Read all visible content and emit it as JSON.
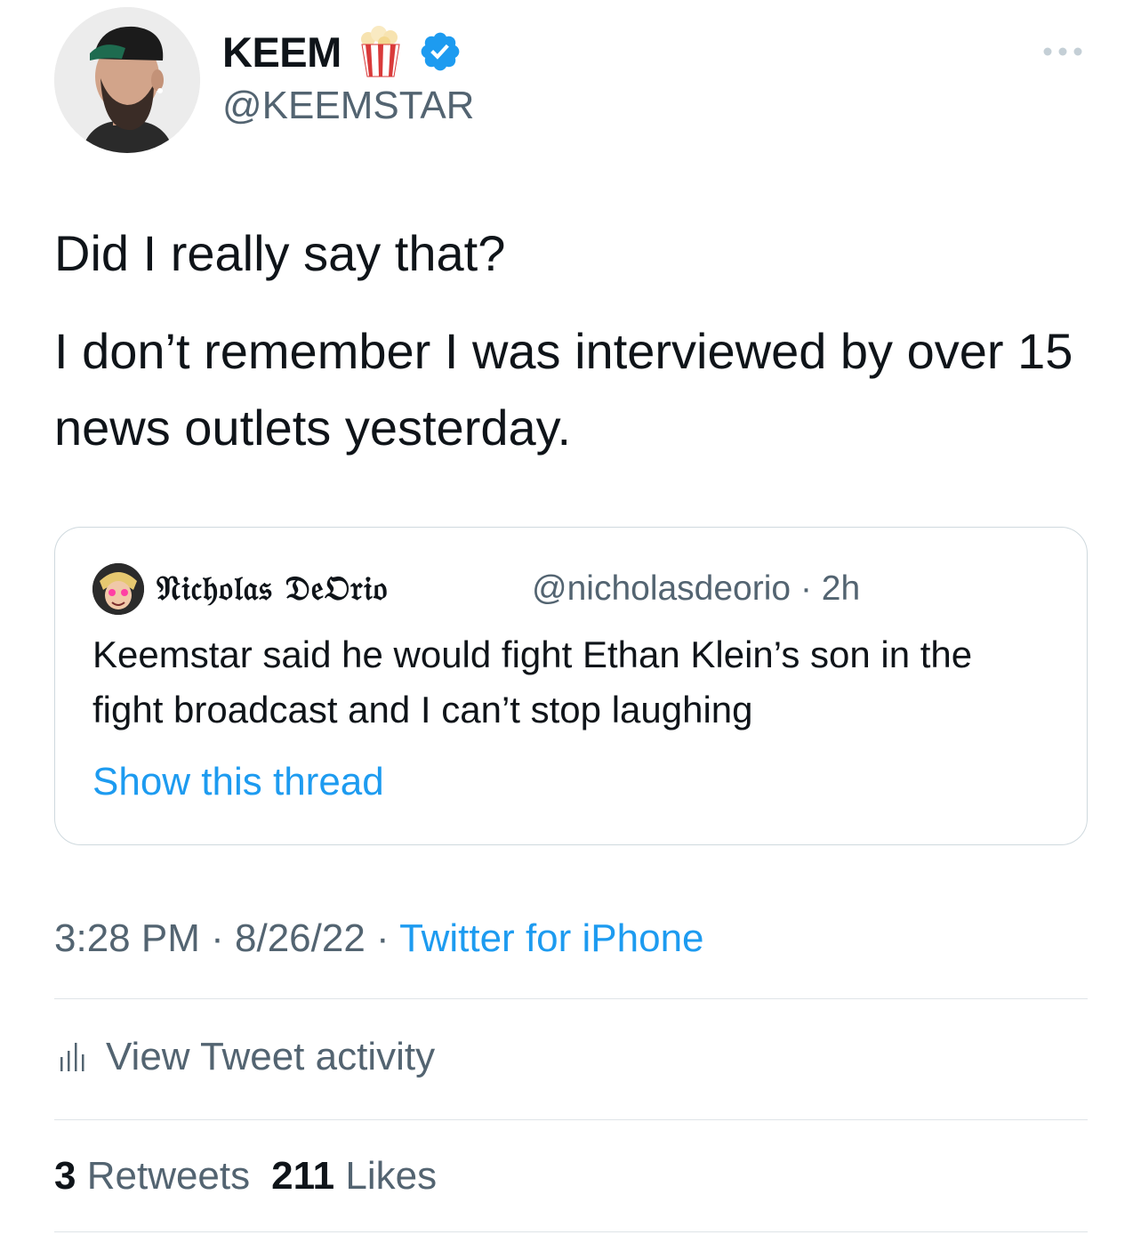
{
  "author": {
    "display_name": "KEEM",
    "name_emoji": "popcorn-icon",
    "verified": true,
    "handle": "@KEEMSTAR"
  },
  "tweet": {
    "lines": [
      "Did I really say that?",
      "I don’t remember I was interviewed by over 15 news outlets yesterday."
    ]
  },
  "quoted_tweet": {
    "display_name": "𝔑𝔦𝔠𝔥𝔬𝔩𝔞𝔰 𝔇𝔢𝔒𝔯𝔦𝔬",
    "handle": "@nicholasdeorio",
    "separator": "·",
    "time": "2h",
    "text": "Keemstar said he would fight Ethan Klein’s son in the fight broadcast and I can’t stop laughing",
    "show_thread_label": "Show this thread"
  },
  "meta": {
    "time": "3:28 PM",
    "separator": "·",
    "date": "8/26/22",
    "source": "Twitter for iPhone"
  },
  "activity": {
    "label": "View Tweet activity"
  },
  "stats": {
    "retweets_count": "3",
    "retweets_label": "Retweets",
    "likes_count": "211",
    "likes_label": "Likes"
  },
  "colors": {
    "link": "#1d9bf0",
    "secondary_text": "#536471",
    "primary_text": "#0f1419",
    "border": "#cfd9de"
  }
}
